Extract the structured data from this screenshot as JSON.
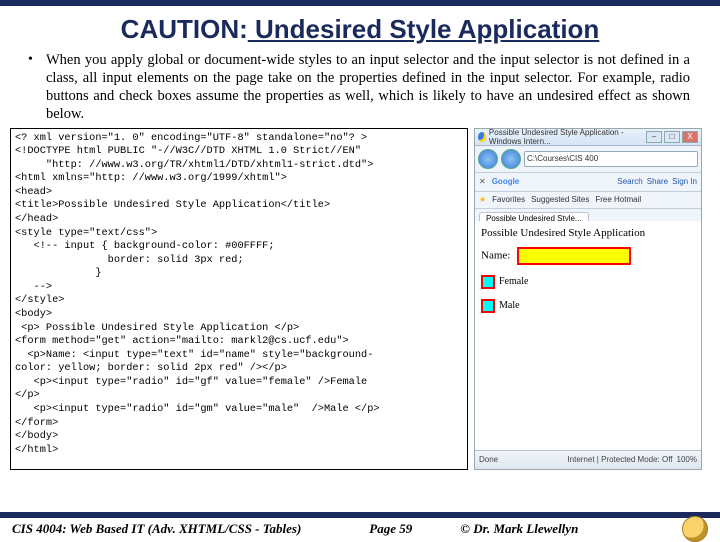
{
  "title": {
    "word1": "CAUTION:",
    "rest": " Undesired Style Application"
  },
  "bullet": "When you apply global or document-wide styles to an input selector and the input selector is not defined in a class, all input elements on the page take on the properties defined in the input selector.  For example, radio buttons and check boxes assume the properties as well, which is likely to have an undesired effect as shown below.",
  "code": "<? xml version=\"1. 0\" encoding=\"UTF-8\" standalone=\"no\"? >\n<!DOCTYPE html PUBLIC \"-//W3C//DTD XHTML 1.0 Strict//EN\"\n     \"http: //www.w3.org/TR/xhtml1/DTD/xhtml1-strict.dtd\">\n<html xmlns=\"http: //www.w3.org/1999/xhtml\">\n<head>\n<title>Possible Undesired Style Application</title>\n</head>\n<style type=\"text/css\">\n   <!-- input { background-color: #00FFFF;\n               border: solid 3px red;\n             }\n   -->\n</style>\n<body>\n <p> Possible Undesired Style Application </p>\n<form method=\"get\" action=\"mailto: markl2@cs.ucf.edu\">\n  <p>Name: <input type=\"text\" id=\"name\" style=\"background-\ncolor: yellow; border: solid 2px red\" /></p>\n   <p><input type=\"radio\" id=\"gf\" value=\"female\" />Female\n</p>\n   <p><input type=\"radio\" id=\"gm\" value=\"male\"  />Male </p>\n</form>\n</body>\n</html>",
  "browser": {
    "titlebar": "Possible Undesired Style Application - Windows Intern...",
    "address": "C:\\Courses\\CIS 400",
    "toolbar": {
      "google": "Google",
      "search": "Search",
      "share": "Share",
      "signin": "Sign In"
    },
    "favbar": {
      "fav": "Favorites",
      "suggested": "Suggested Sites",
      "hotmail": "Free Hotmail"
    },
    "tab": "Possible Undesired Style...",
    "page": {
      "heading": "Possible Undesired Style Application",
      "name_label": "Name:",
      "female": "Female",
      "male": "Male"
    },
    "status": {
      "done": "Done",
      "mode": "Internet | Protected Mode: Off",
      "zoom": "100%"
    }
  },
  "footer": {
    "course": "CIS 4004: Web Based IT (Adv. XHTML/CSS - Tables)",
    "page": "Page 59",
    "copyright": "© Dr. Mark Llewellyn"
  }
}
